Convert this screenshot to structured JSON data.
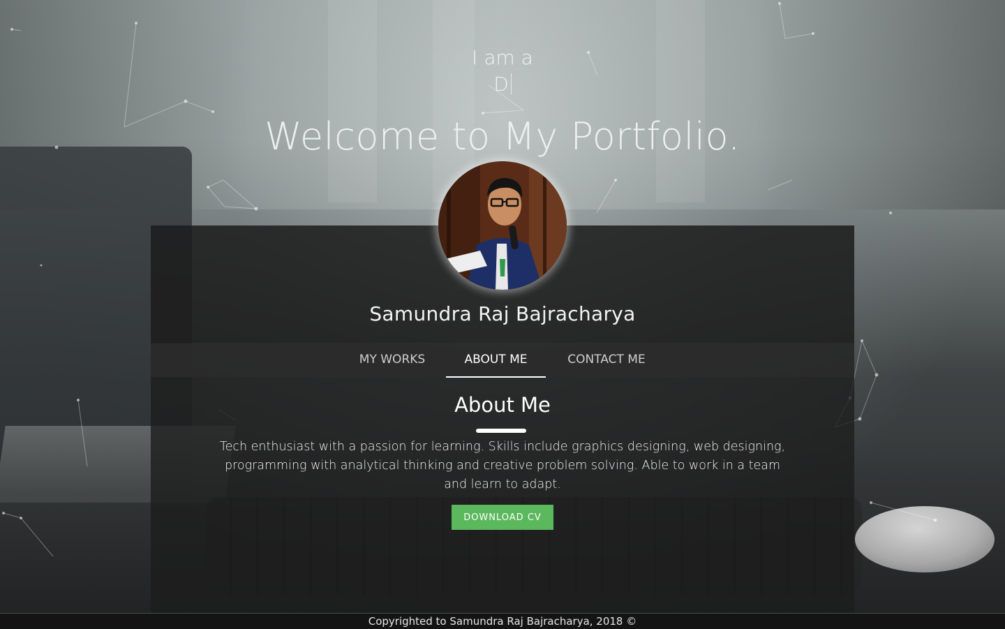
{
  "hero": {
    "intro": "I am a",
    "typed_text": "D",
    "welcome": "Welcome to My Portfolio."
  },
  "profile": {
    "name": "Samundra Raj Bajracharya"
  },
  "tabs": [
    {
      "label": "MY WORKS"
    },
    {
      "label": "ABOUT ME"
    },
    {
      "label": "CONTACT ME"
    }
  ],
  "active_tab": "ABOUT ME",
  "about": {
    "title": "About Me",
    "text": "Tech enthusiast with a passion for learning. Skills include graphics designing, web designing, programming with analytical thinking and creative problem solving. Able to work in a team and learn to adapt.",
    "cv_button": "DOWNLOAD CV"
  },
  "footer": {
    "text": "Copyrighted to Samundra Raj Bajracharya, 2018 ©"
  },
  "colors": {
    "button_green": "#5cb85c",
    "card_dark": "#1c1c1c",
    "text_light": "#f0f0f0"
  }
}
